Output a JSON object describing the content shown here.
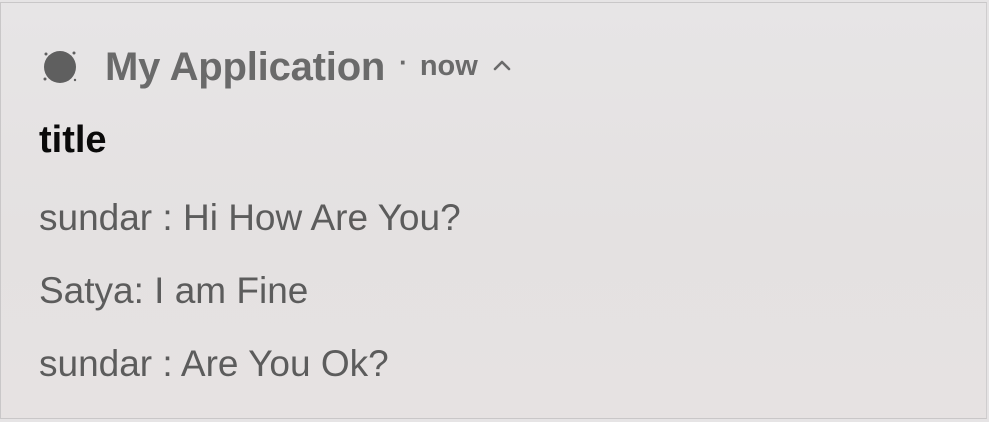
{
  "notification": {
    "app_icon": "app-circle-icon",
    "app_name": "My Application",
    "separator": "·",
    "time": "now",
    "expand_icon": "chevron-up-icon",
    "title": "title",
    "lines": [
      "sundar : Hi How Are You?",
      "Satya: I am Fine",
      "sundar : Are You Ok?"
    ]
  },
  "colors": {
    "background": "#e6e4e5",
    "header_text": "#6a6a6a",
    "title_text": "#0a0a0a",
    "body_text": "#5c5c5c"
  }
}
